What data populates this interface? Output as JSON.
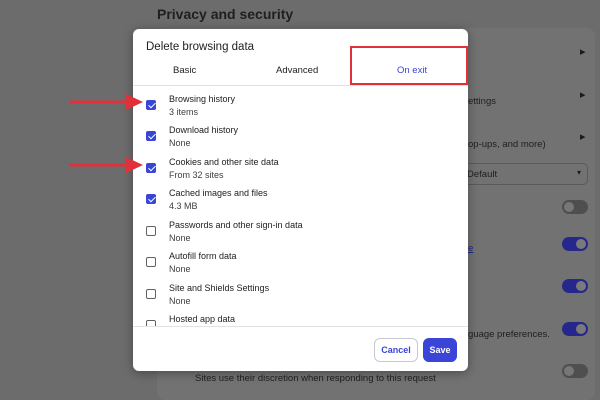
{
  "background": {
    "heading": "Privacy and security",
    "rows": [
      {
        "text": "ettings"
      },
      {
        "text": "op-ups, and more)"
      },
      {
        "text": "guage preferences."
      },
      {
        "text": "Sites use their discretion when responding to this request"
      }
    ],
    "select_value": "Default",
    "link_fragment": "e"
  },
  "dialog": {
    "title": "Delete browsing data",
    "tabs": [
      {
        "label": "Basic",
        "active": false
      },
      {
        "label": "Advanced",
        "active": false
      },
      {
        "label": "On exit",
        "active": true
      }
    ],
    "items": [
      {
        "label": "Browsing history",
        "sub": "3 items",
        "checked": true
      },
      {
        "label": "Download history",
        "sub": "None",
        "checked": true
      },
      {
        "label": "Cookies and other site data",
        "sub": "From 32 sites",
        "checked": true
      },
      {
        "label": "Cached images and files",
        "sub": "4.3 MB",
        "checked": true
      },
      {
        "label": "Passwords and other sign-in data",
        "sub": "None",
        "checked": false
      },
      {
        "label": "Autofill form data",
        "sub": "None",
        "checked": false
      },
      {
        "label": "Site and Shields Settings",
        "sub": "None",
        "checked": false
      },
      {
        "label": "Hosted app data",
        "sub": "",
        "checked": false
      }
    ],
    "cancel_label": "Cancel",
    "save_label": "Save"
  },
  "colors": {
    "accent": "#3a44d6",
    "annotation": "#e0303a"
  }
}
